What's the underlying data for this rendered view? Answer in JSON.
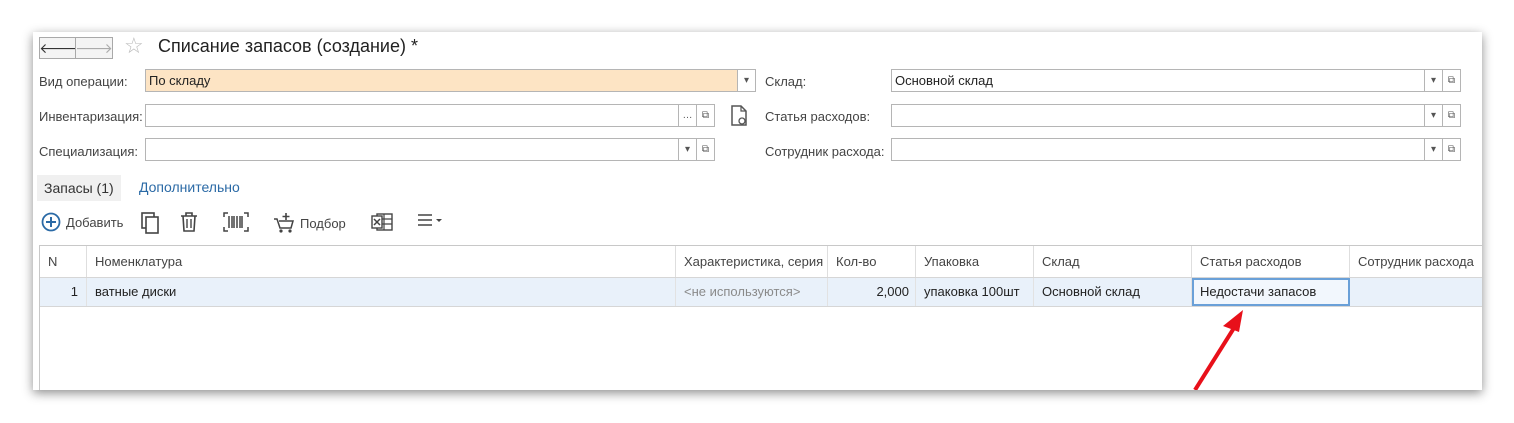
{
  "window": {
    "title": "Списание запасов (создание) *"
  },
  "nav": {
    "back": "🡐",
    "forward": "🡒",
    "favorite": "☆"
  },
  "form": {
    "operation_type": {
      "label": "Вид операции:",
      "value": "По складу"
    },
    "inventory": {
      "label": "Инвентаризация:",
      "value": ""
    },
    "specialization": {
      "label": "Специализация:",
      "value": ""
    },
    "warehouse": {
      "label": "Склад:",
      "value": "Основной склад"
    },
    "expense_item": {
      "label": "Статья расходов:",
      "value": ""
    },
    "expense_employee": {
      "label": "Сотрудник расхода:",
      "value": ""
    }
  },
  "tabs": [
    {
      "label": "Запасы (1)",
      "active": true
    },
    {
      "label": "Дополнительно",
      "active": false
    }
  ],
  "toolbar": {
    "add_label": "Добавить",
    "pick_label": "Подбор"
  },
  "table": {
    "columns": [
      "N",
      "Номенклатура",
      "Характеристика, серия",
      "Кол-во",
      "Упаковка",
      "Склад",
      "Статья расходов",
      "Сотрудник расхода"
    ],
    "rows": [
      {
        "n": "1",
        "item": "ватные диски",
        "characteristic": "<не используются>",
        "qty": "2,000",
        "package": "упаковка 100шт",
        "warehouse": "Основной склад",
        "expense_item": "Недостачи запасов",
        "employee": ""
      }
    ]
  },
  "colors": {
    "accent": "#2b6aa6",
    "highlight_field": "#fde4c4",
    "selection_row": "#e9f1fa",
    "annotation_arrow": "#e8101a"
  }
}
